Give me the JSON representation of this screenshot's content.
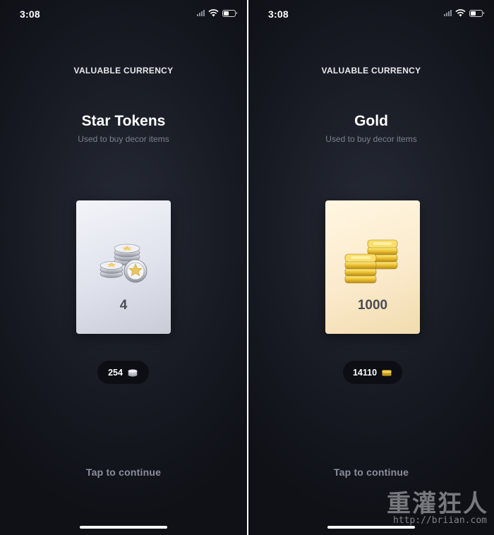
{
  "screens": [
    {
      "status_time": "3:08",
      "eyebrow": "VALUABLE CURRENCY",
      "title": "Star Tokens",
      "subtitle": "Used to buy decor items",
      "card": {
        "icon": "silver-star-coins-icon",
        "value": "4",
        "accent": "#dfe2ec"
      },
      "balance": {
        "amount": "254",
        "icon": "silver-coin-icon"
      },
      "tap_label": "Tap to continue"
    },
    {
      "status_time": "3:08",
      "eyebrow": "VALUABLE CURRENCY",
      "title": "Gold",
      "subtitle": "Used to buy decor items",
      "card": {
        "icon": "gold-bars-icon",
        "value": "1000",
        "accent": "#fbeacc"
      },
      "balance": {
        "amount": "14110",
        "icon": "gold-bar-icon"
      },
      "tap_label": "Tap to continue"
    }
  ],
  "watermark": {
    "brand": "重灌狂人",
    "url": "http://briian.com"
  }
}
